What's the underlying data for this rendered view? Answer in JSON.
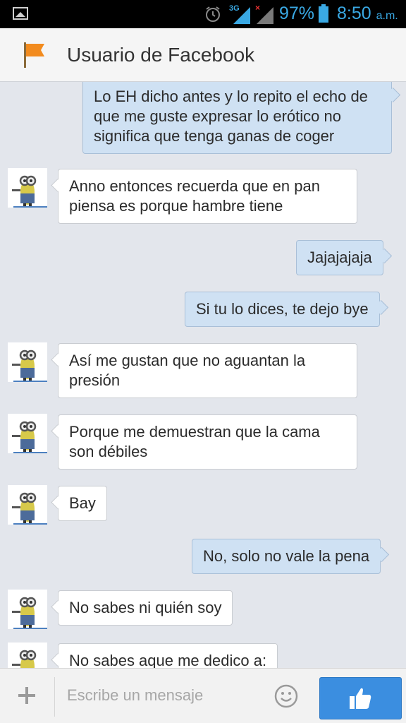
{
  "status_bar": {
    "network_label": "3G",
    "battery_percent": "97%",
    "time": "8:50",
    "time_suffix": "a.m.",
    "colors": {
      "icons": "#3aa9e4"
    }
  },
  "header": {
    "title": "Usuario de Facebook",
    "icon": "flag-icon",
    "flag_color": "#f28b1e"
  },
  "messages": [
    {
      "side": "out",
      "text": "Lo EH dicho antes y lo repito el echo de que me guste expresar lo erótico no significa que tenga ganas de coger"
    },
    {
      "side": "in",
      "text": "Anno entonces recuerda que en pan piensa es porque hambre tiene"
    },
    {
      "side": "out",
      "text": "Jajajajaja"
    },
    {
      "side": "out",
      "text": "Si tu lo dices, te dejo bye"
    },
    {
      "side": "in",
      "text": "Así me gustan que no aguantan la presión"
    },
    {
      "side": "in",
      "text": "Porque me demuestran que la cama son débiles"
    },
    {
      "side": "in",
      "text": "Bay"
    },
    {
      "side": "out",
      "text": "No, solo no vale la pena"
    },
    {
      "side": "in",
      "text": "No sabes ni quién soy"
    },
    {
      "side": "in",
      "text": "No sabes aque me dedico a:"
    }
  ],
  "composer": {
    "placeholder": "Escribe un mensaje",
    "add_icon": "plus-icon",
    "emoji_icon": "smiley-icon",
    "send_icon": "thumbs-up-icon",
    "like_color": "#3b8ee0"
  },
  "colors": {
    "outgoing_bubble": "#cfe1f3",
    "incoming_bubble": "#ffffff",
    "background": "#e3e6ec"
  }
}
